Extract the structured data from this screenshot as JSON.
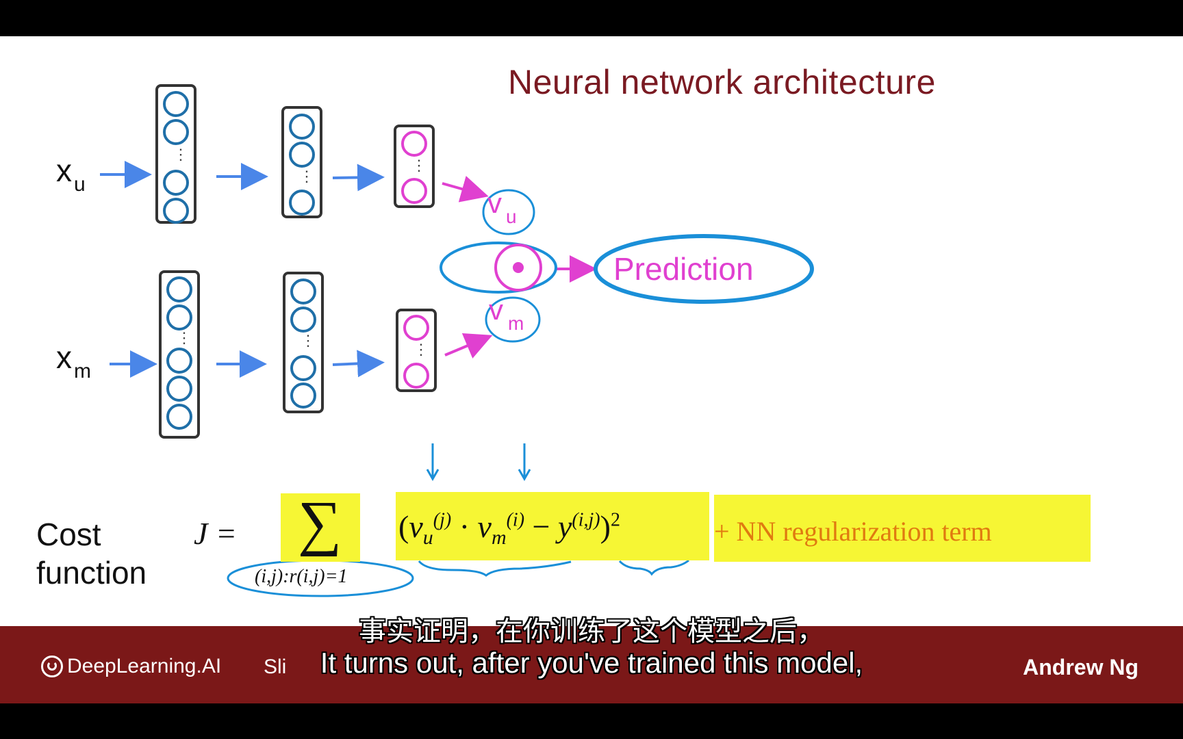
{
  "slide": {
    "title": "Neural network architecture",
    "input_user": {
      "base": "x",
      "sub": "u"
    },
    "input_movie": {
      "base": "x",
      "sub": "m"
    },
    "vector_user": {
      "base": "v",
      "sub": "u"
    },
    "vector_movie": {
      "base": "v",
      "sub": "m"
    },
    "dot_symbol": "•",
    "prediction_label": "Prediction",
    "cost_label_line1": "Cost",
    "cost_label_line2": "function",
    "cost_lhs": "J =",
    "sum_symbol": "∑",
    "sum_index": "(i,j):r(i,j)=1",
    "cost_term": "(v_u^(j) · v_m^(i) − y^(i,j))^2",
    "regularization": "+ NN regularization  term",
    "colors": {
      "title": "#7a1a22",
      "arrow_blue": "#4a86e8",
      "node_blue": "#1f6fa8",
      "magenta": "#e040d0",
      "annotation_blue": "#1a8fd8",
      "highlight": "#f6f634",
      "footer": "#7b1818"
    }
  },
  "footer": {
    "brand": "DeepLearning.AI",
    "slide_tag": "Sli",
    "author": "Andrew Ng"
  },
  "subtitles": {
    "chinese": "事实证明，在你训练了这个模型之后，",
    "english": "It turns out, after you've trained this model,"
  }
}
